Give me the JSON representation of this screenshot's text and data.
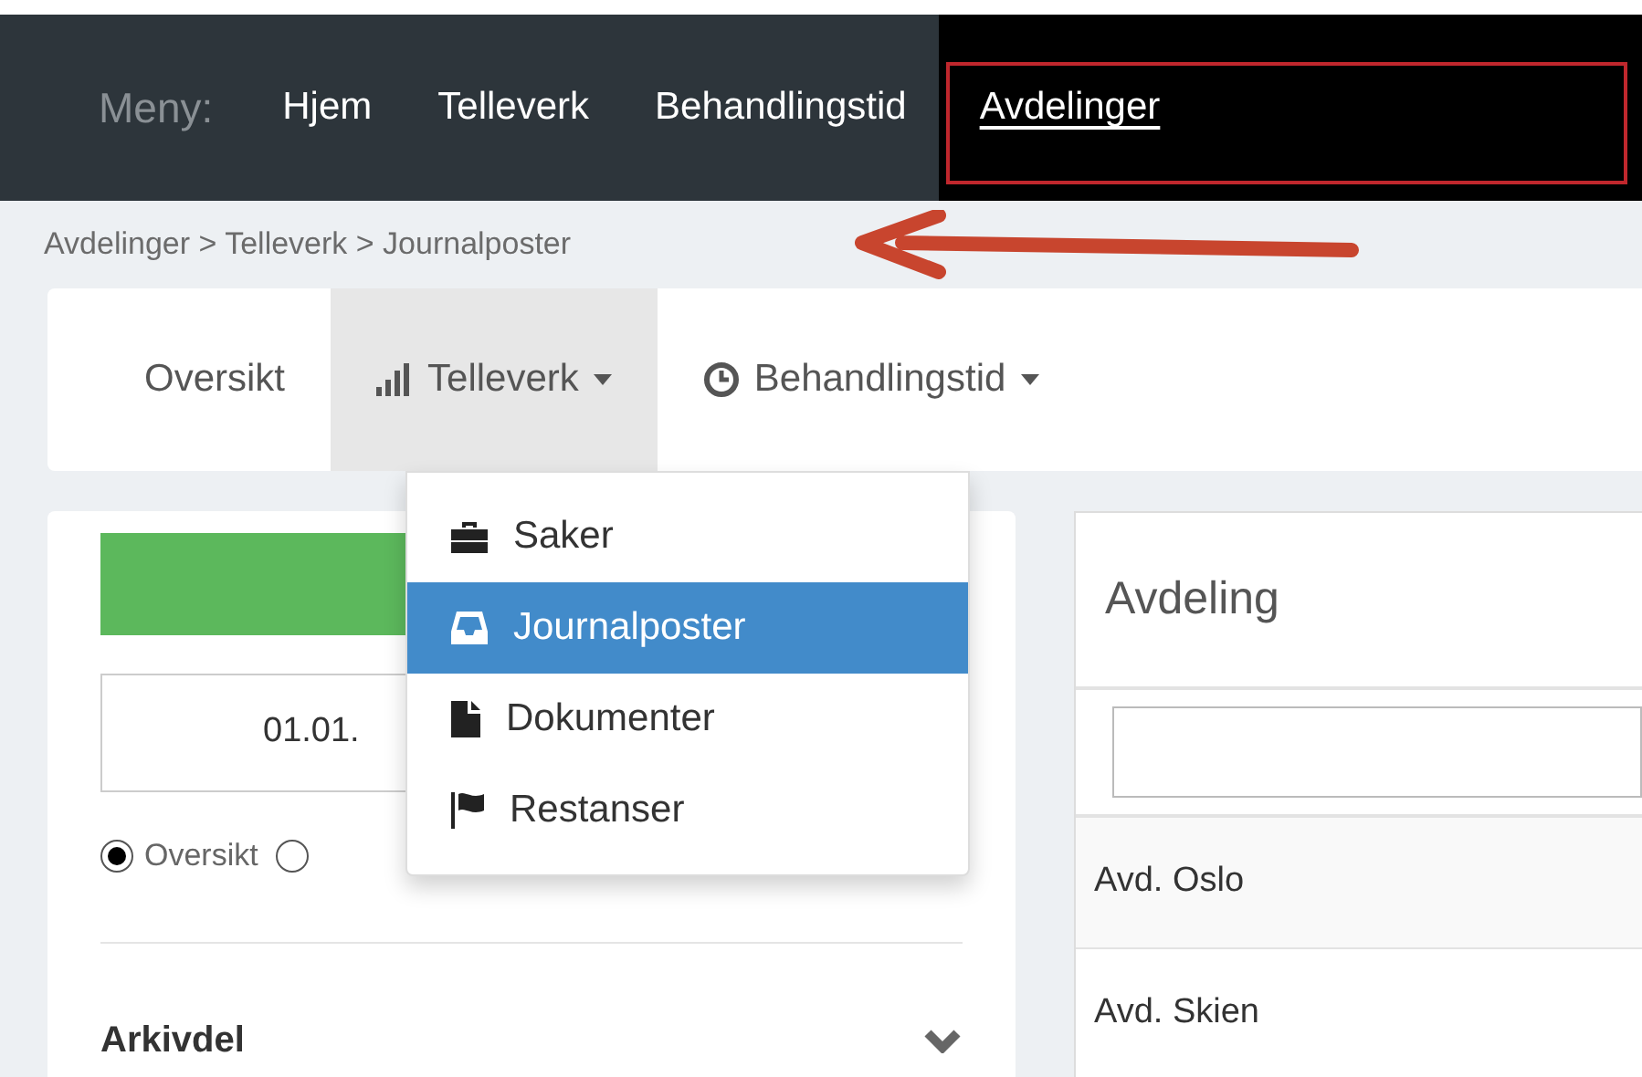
{
  "navbar": {
    "label": "Meny:",
    "items": [
      {
        "label": "Hjem",
        "selected": false,
        "highlighted": false
      },
      {
        "label": "Telleverk",
        "selected": false,
        "highlighted": false
      },
      {
        "label": "Behandlingstid",
        "selected": false,
        "highlighted": false
      },
      {
        "label": "Avdelinger",
        "selected": true,
        "highlighted": true
      }
    ]
  },
  "breadcrumb": {
    "text": "Avdelinger > Telleverk > Journalposter",
    "annotated": true
  },
  "tabs": [
    {
      "label": "Oversikt",
      "kind": "plain",
      "selected": false
    },
    {
      "label": "Telleverk",
      "kind": "bars",
      "selected": true
    },
    {
      "label": "Behandlingstid",
      "kind": "clock",
      "selected": false
    }
  ],
  "dropdown": {
    "items": [
      {
        "label": "Saker",
        "kind": "briefcase",
        "selected": false
      },
      {
        "label": "Journalposter",
        "kind": "inbox",
        "selected": true
      },
      {
        "label": "Dokumenter",
        "kind": "file",
        "selected": false
      },
      {
        "label": "Restanser",
        "kind": "flag",
        "selected": false
      }
    ]
  },
  "filter_panel": {
    "date": "01.01.",
    "radios": [
      {
        "label": "Oversikt",
        "checked": true
      },
      {
        "checked": false
      }
    ],
    "section": "Arkivdel"
  },
  "table": {
    "title": "Avdeling",
    "rows": [
      "Avd. Oslo",
      "Avd. Skien"
    ]
  }
}
